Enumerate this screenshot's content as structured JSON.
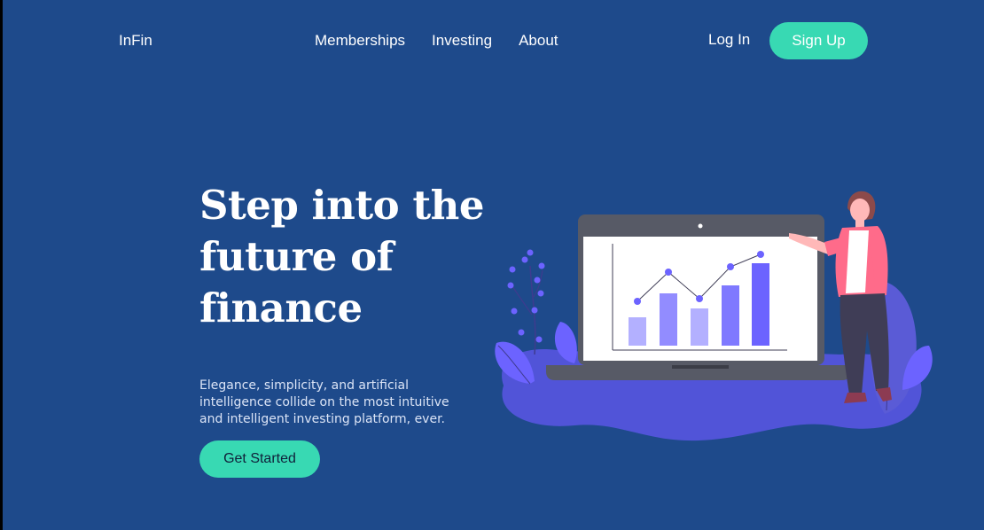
{
  "header": {
    "brand": "InFin",
    "nav": [
      {
        "label": "Memberships"
      },
      {
        "label": "Investing"
      },
      {
        "label": "About"
      }
    ],
    "login_label": "Log In",
    "signup_label": "Sign Up"
  },
  "hero": {
    "title": "Step into the future of finance",
    "subtitle": "Elegance, simplicity, and artificial intelligence collide on the most intuitive and intelligent investing platform, ever.",
    "cta_label": "Get Started"
  },
  "colors": {
    "background": "#1e4a8b",
    "accent": "#38d9b3",
    "illustration_primary": "#6c63ff",
    "illustration_blob": "#5a5bd6",
    "laptop": "#575a66",
    "person_shirt": "#ff6b8a"
  },
  "illustration": {
    "icon": "finance-chart-illustration",
    "bar_values": [
      0.32,
      0.57,
      0.42,
      0.67,
      0.93
    ],
    "line_points": [
      0.5,
      0.8,
      0.52,
      0.85,
      0.97
    ]
  }
}
